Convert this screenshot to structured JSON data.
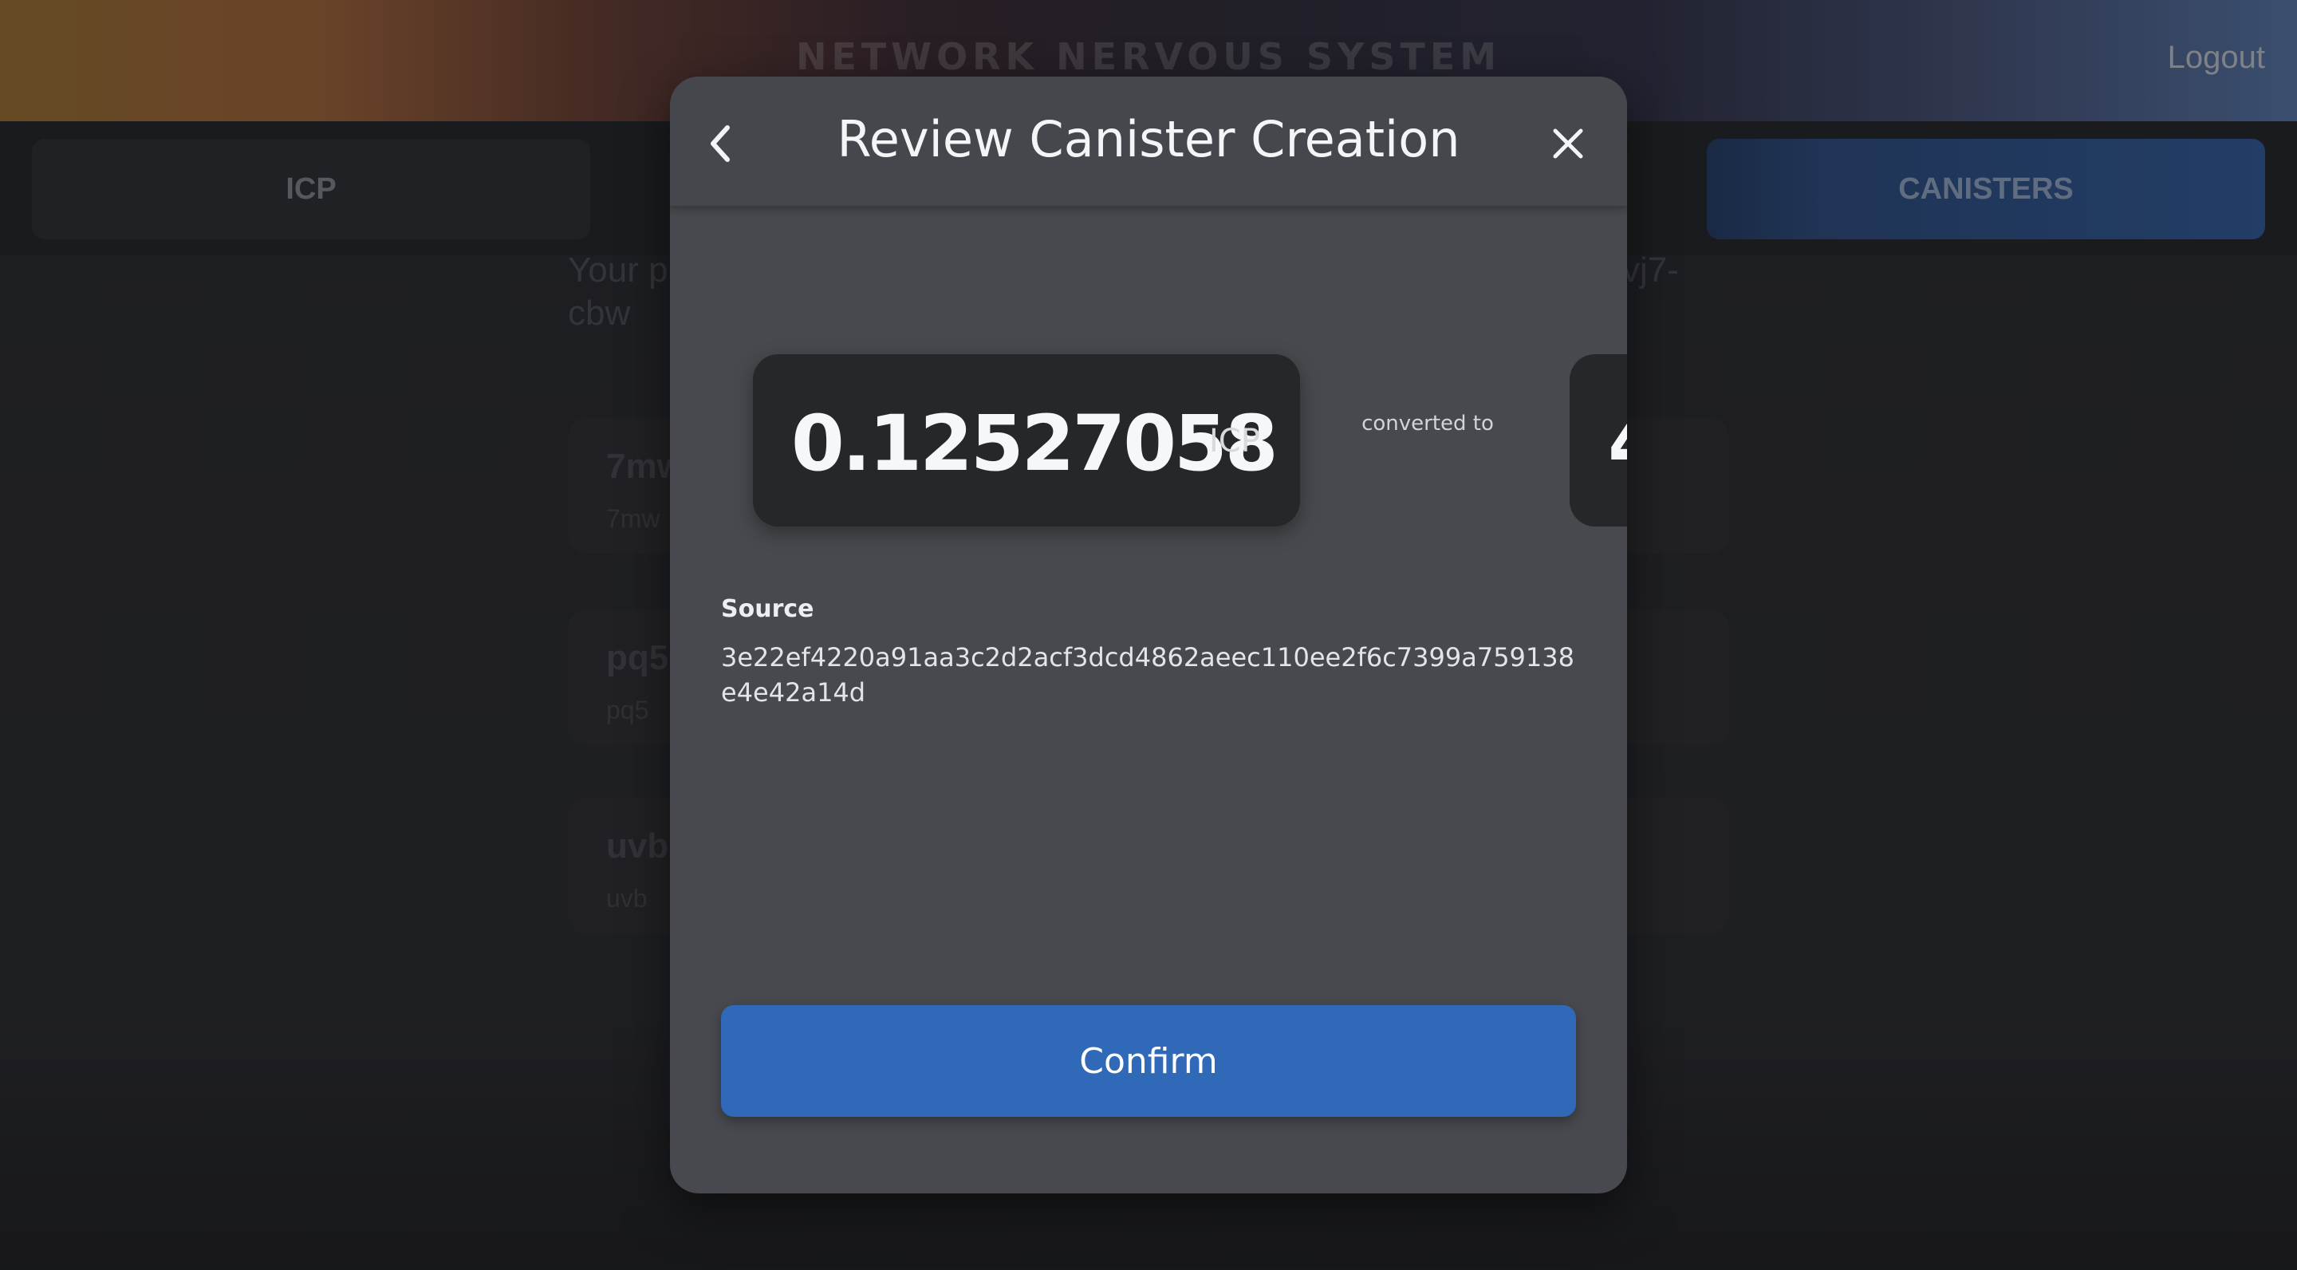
{
  "header": {
    "brand": "NETWORK NERVOUS SYSTEM",
    "logout_label": "Logout"
  },
  "tabs": {
    "icp_label": "ICP",
    "canisters_label": "CANISTERS"
  },
  "background_content": {
    "info_line_1": "Your p",
    "info_line_1_end": "vj7-",
    "info_line_2": "cbw",
    "cards": [
      {
        "title": "7mw",
        "subtitle": "7mw"
      },
      {
        "title": "pq5",
        "subtitle": "pq5"
      },
      {
        "title": "uvb",
        "subtitle": "uvb"
      }
    ]
  },
  "modal": {
    "title": "Review Canister Creation",
    "amount": "0.12527058",
    "amount_unit": "ICP",
    "converted_label": "converted to",
    "cycles_partial": "4",
    "source_label": "Source",
    "source_value": "3e22ef4220a91aa3c2d2acf3dcd4862aeec110ee2f6c7399a759138e4e42a14d",
    "confirm_label": "Confirm"
  },
  "colors": {
    "accent": "#2f69b8",
    "modal_bg": "#47494e",
    "card_bg": "#262729"
  }
}
